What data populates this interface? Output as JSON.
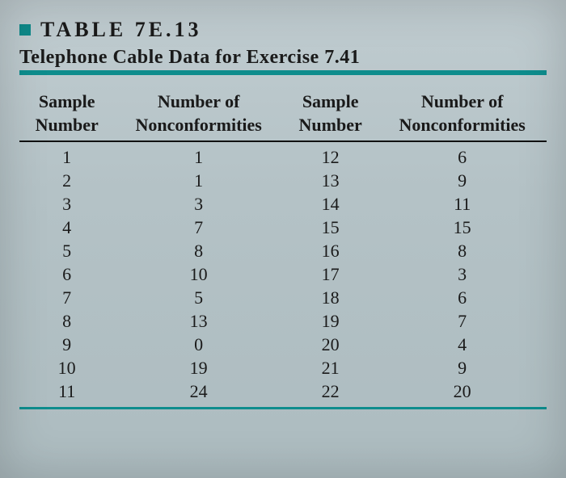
{
  "table_label": "TABLE 7E.13",
  "subtitle": "Telephone Cable Data for Exercise 7.41",
  "headers": {
    "col1_top": "Sample",
    "col1_bot": "Number",
    "col2_top": "Number of",
    "col2_bot": "Nonconformities",
    "col3_top": "Sample",
    "col3_bot": "Number",
    "col4_top": "Number of",
    "col4_bot": "Nonconformities"
  },
  "rows": [
    {
      "a": "1",
      "b": "1",
      "c": "12",
      "d": "6"
    },
    {
      "a": "2",
      "b": "1",
      "c": "13",
      "d": "9"
    },
    {
      "a": "3",
      "b": "3",
      "c": "14",
      "d": "11"
    },
    {
      "a": "4",
      "b": "7",
      "c": "15",
      "d": "15"
    },
    {
      "a": "5",
      "b": "8",
      "c": "16",
      "d": "8"
    },
    {
      "a": "6",
      "b": "10",
      "c": "17",
      "d": "3"
    },
    {
      "a": "7",
      "b": "5",
      "c": "18",
      "d": "6"
    },
    {
      "a": "8",
      "b": "13",
      "c": "19",
      "d": "7"
    },
    {
      "a": "9",
      "b": "0",
      "c": "20",
      "d": "4"
    },
    {
      "a": "10",
      "b": "19",
      "c": "21",
      "d": "9"
    },
    {
      "a": "11",
      "b": "24",
      "c": "22",
      "d": "20"
    }
  ],
  "chart_data": {
    "type": "table",
    "title": "Telephone Cable Data for Exercise 7.41",
    "columns": [
      "Sample Number",
      "Number of Nonconformities"
    ],
    "data": [
      [
        1,
        1
      ],
      [
        2,
        1
      ],
      [
        3,
        3
      ],
      [
        4,
        7
      ],
      [
        5,
        8
      ],
      [
        6,
        10
      ],
      [
        7,
        5
      ],
      [
        8,
        13
      ],
      [
        9,
        0
      ],
      [
        10,
        19
      ],
      [
        11,
        24
      ],
      [
        12,
        6
      ],
      [
        13,
        9
      ],
      [
        14,
        11
      ],
      [
        15,
        15
      ],
      [
        16,
        8
      ],
      [
        17,
        3
      ],
      [
        18,
        6
      ],
      [
        19,
        7
      ],
      [
        20,
        4
      ],
      [
        21,
        9
      ],
      [
        22,
        20
      ]
    ]
  }
}
